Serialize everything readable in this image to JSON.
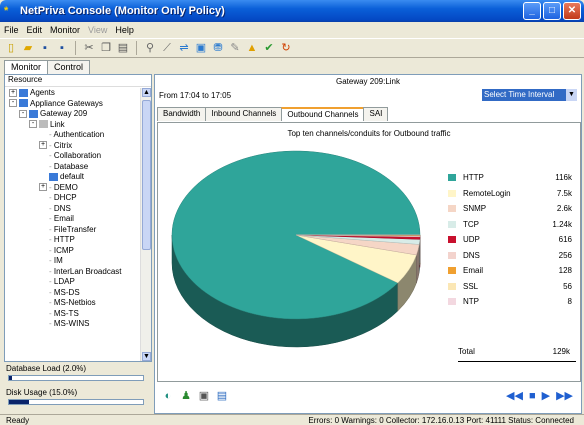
{
  "window": {
    "title": "NetPriva Console (Monitor Only Policy)"
  },
  "menu": [
    {
      "label": "File",
      "disabled": false
    },
    {
      "label": "Edit",
      "disabled": false
    },
    {
      "label": "Monitor",
      "disabled": false
    },
    {
      "label": "View",
      "disabled": true
    },
    {
      "label": "Help",
      "disabled": false
    }
  ],
  "tabs": {
    "monitor": "Monitor",
    "control": "Control"
  },
  "left": {
    "header": "Resource",
    "tree": [
      {
        "label": "Agents",
        "level": 0,
        "exp": "+"
      },
      {
        "label": "Appliance Gateways",
        "level": 0,
        "exp": "-"
      },
      {
        "label": "Gateway 209",
        "level": 1,
        "exp": "-"
      },
      {
        "label": "Link",
        "level": 2,
        "exp": "-"
      },
      {
        "label": "Authentication",
        "level": 3,
        "exp": ""
      },
      {
        "label": "Citrix",
        "level": 3,
        "exp": "+"
      },
      {
        "label": "Collaboration",
        "level": 3,
        "exp": ""
      },
      {
        "label": "Database",
        "level": 3,
        "exp": ""
      },
      {
        "label": "default",
        "level": 3,
        "exp": ""
      },
      {
        "label": "DEMO",
        "level": 3,
        "exp": "+"
      },
      {
        "label": "DHCP",
        "level": 3,
        "exp": ""
      },
      {
        "label": "DNS",
        "level": 3,
        "exp": ""
      },
      {
        "label": "Email",
        "level": 3,
        "exp": ""
      },
      {
        "label": "FileTransfer",
        "level": 3,
        "exp": ""
      },
      {
        "label": "HTTP",
        "level": 3,
        "exp": ""
      },
      {
        "label": "ICMP",
        "level": 3,
        "exp": ""
      },
      {
        "label": "IM",
        "level": 3,
        "exp": ""
      },
      {
        "label": "InterLan Broadcast",
        "level": 3,
        "exp": ""
      },
      {
        "label": "LDAP",
        "level": 3,
        "exp": ""
      },
      {
        "label": "MS-DS",
        "level": 3,
        "exp": ""
      },
      {
        "label": "MS-Netbios",
        "level": 3,
        "exp": ""
      },
      {
        "label": "MS-TS",
        "level": 3,
        "exp": ""
      },
      {
        "label": "MS-WINS",
        "level": 3,
        "exp": ""
      }
    ],
    "database_load": {
      "label": "Database Load (2.0%)",
      "value": 0.02
    },
    "disk_usage": {
      "label": "Disk Usage (15.0%)",
      "value": 0.15
    }
  },
  "right": {
    "gateway_title": "Gateway 209:Link",
    "time_range": "From 17:04  to 17:05",
    "time_select": "Select Time Interval",
    "subtabs": [
      "Bandwidth",
      "Inbound Channels",
      "Outbound Channels",
      "SAI"
    ],
    "active_subtab": 2
  },
  "chart_data": {
    "type": "pie",
    "title": "Top ten channels/conduits for Outbound traffic",
    "slices": [
      {
        "label": "HTTP",
        "display": "116k",
        "value": 116000,
        "color": "#2fa59a"
      },
      {
        "label": "RemoteLogin",
        "display": "7.5k",
        "value": 7500,
        "color": "#fff5c8"
      },
      {
        "label": "SNMP",
        "display": "2.6k",
        "value": 2600,
        "color": "#f5d6c6"
      },
      {
        "label": "TCP",
        "display": "1.24k",
        "value": 1240,
        "color": "#d8ece8"
      },
      {
        "label": "UDP",
        "display": "616",
        "value": 616,
        "color": "#c8102e"
      },
      {
        "label": "DNS",
        "display": "256",
        "value": 256,
        "color": "#f3d3cd"
      },
      {
        "label": "Email",
        "display": "128",
        "value": 128,
        "color": "#f0a030"
      },
      {
        "label": "SSL",
        "display": "56",
        "value": 56,
        "color": "#fbe7b5"
      },
      {
        "label": "NTP",
        "display": "8",
        "value": 8,
        "color": "#f3d8e0"
      }
    ],
    "total_label": "Total",
    "total_display": "129k"
  },
  "status": {
    "left": "Ready",
    "right": "Errors: 0  Warnings: 0  Collector: 172.16.0.13  Port: 41111  Status: Connected"
  }
}
